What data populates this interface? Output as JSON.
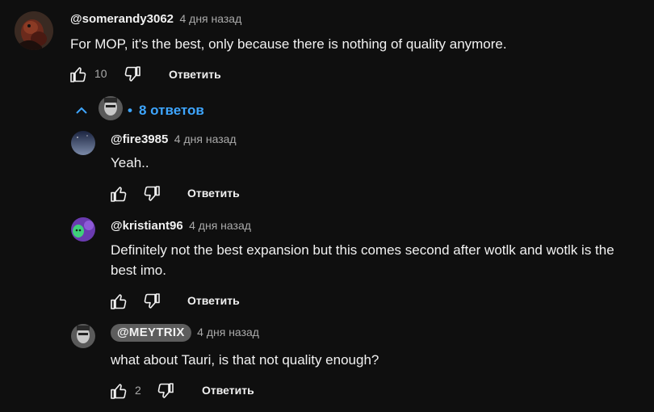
{
  "comment": {
    "author": "@somerandy3062",
    "time": "4 дня назад",
    "text": "For MOP, it's the best, only because there is nothing of quality anymore.",
    "likes": "10",
    "reply_label": "Ответить"
  },
  "replies_toggle": {
    "bullet": "•",
    "label": "8 ответов"
  },
  "replies": [
    {
      "author": "@fire3985",
      "time": "4 дня назад",
      "text": "Yeah..",
      "likes": "",
      "reply_label": "Ответить"
    },
    {
      "author": "@kristiant96",
      "time": "4 дня назад",
      "text": "Definitely not the best expansion but this comes second after wotlk and wotlk is the best imo.",
      "likes": "",
      "reply_label": "Ответить"
    },
    {
      "author": "@MEYTRIX",
      "time": "4 дня назад",
      "text": "what about Tauri, is that not quality enough?",
      "likes": "2",
      "reply_label": "Ответить"
    }
  ],
  "colors": {
    "background": "#0f0f0f",
    "link": "#3ea6ff",
    "secondary_text": "#aaaaaa",
    "creator_pill": "#5d5d5d"
  },
  "icons": [
    "thumb-up-icon",
    "thumb-down-icon",
    "chevron-up-icon"
  ]
}
